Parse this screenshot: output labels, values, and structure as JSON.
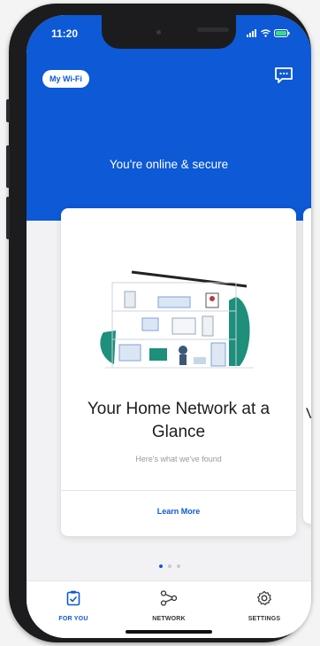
{
  "status_bar": {
    "time": "11:20"
  },
  "header": {
    "wifi_button": "My Wi-Fi",
    "headline": "You're online & secure"
  },
  "card": {
    "title": "Your Home Network at a Glance",
    "subtitle": "Here's what we've found",
    "link": "Learn More"
  },
  "next_card_peek": "V",
  "pager": {
    "count": 3,
    "active": 1
  },
  "tabs": [
    {
      "label": "FOR YOU",
      "icon": "checklist-icon",
      "active": true
    },
    {
      "label": "NETWORK",
      "icon": "network-icon",
      "active": false
    },
    {
      "label": "SETTINGS",
      "icon": "gear-icon",
      "active": false
    }
  ],
  "colors": {
    "brand_blue": "#0d59d6",
    "teal": "#1d8f7a"
  }
}
